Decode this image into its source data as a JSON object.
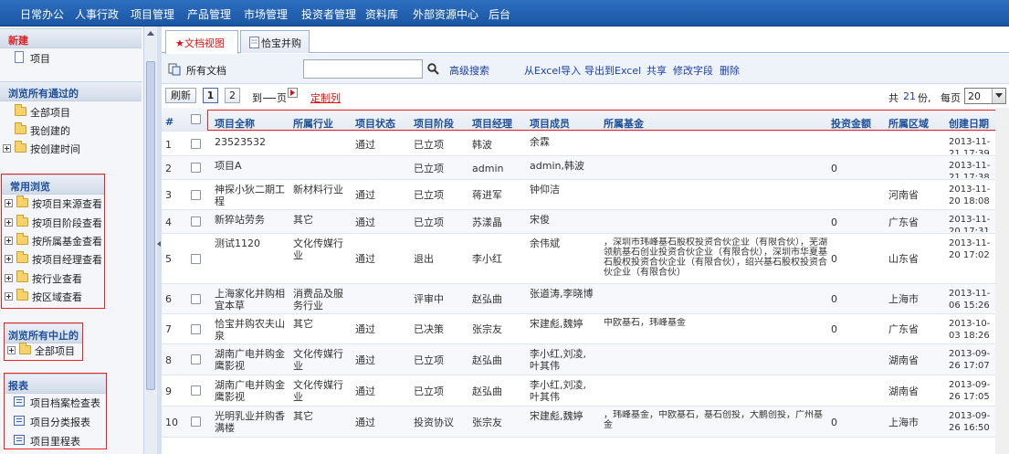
{
  "nav": [
    "日常办公",
    "人事行政",
    "项目管理",
    "产品管理",
    "市场管理",
    "投资者管理",
    "资料库",
    "外部资源中心",
    "后台"
  ],
  "sidebar": {
    "new_title": "新建",
    "new_items": [
      "项目"
    ],
    "browse_title": "浏览所有通过的",
    "browse_items": [
      "全部项目",
      "我创建的",
      "按创建时间"
    ],
    "common_title": "常用浏览",
    "common_items": [
      "按项目来源查看",
      "按项目阶段查看",
      "按所属基金查看",
      "按项目经理查看",
      "按行业查看",
      "按区域查看"
    ],
    "stopped_title": "浏览所有中止的",
    "stopped_items": [
      "全部项目"
    ],
    "reports_title": "报表",
    "report_items": [
      "项目档案检查表",
      "项目分类报表",
      "项目里程表"
    ]
  },
  "tabs": [
    "★文档视图",
    "恰宝并购"
  ],
  "toolbar": {
    "all_docs": "所有文档",
    "search_value": "",
    "advanced_search": "高级搜索",
    "import_excel": "从Excel导入",
    "export_excel": "导出到Excel",
    "share": "共享",
    "modify_fields": "修改字段",
    "delete": "删除"
  },
  "pager": {
    "refresh": "刷新",
    "pages": [
      "1",
      "2"
    ],
    "goto_prefix": "到",
    "goto_suffix": "页",
    "custom_columns": "定制列",
    "total_prefix": "共",
    "total_count": "21",
    "total_suffix": "份,",
    "per_page_label": "每页",
    "per_page": "20"
  },
  "columns": [
    "#",
    "",
    "项目全称",
    "所属行业",
    "项目状态",
    "项目阶段",
    "项目经理",
    "项目成员",
    "所属基金",
    "投资金额",
    "所属区域",
    "创建日期"
  ],
  "rows": [
    [
      "1",
      "",
      "23523532",
      "",
      "通过",
      "已立项",
      "韩波",
      "余霖",
      "",
      "",
      "",
      "2013-11-21 17:39"
    ],
    [
      "2",
      "",
      "项目A",
      "",
      "",
      "已立项",
      "admin",
      "admin,韩波",
      "",
      "0",
      "",
      "2013-11-21 17:38"
    ],
    [
      "3",
      "",
      "神探小狄二期工程",
      "新材料行业",
      "通过",
      "已立项",
      "蒋进军",
      "钟仰洁",
      "",
      "",
      "河南省",
      "2013-11-20 18:08"
    ],
    [
      "4",
      "",
      "新猝站劳务",
      "其它",
      "通过",
      "已立项",
      "苏漾晶",
      "宋俊",
      "",
      "0",
      "广东省",
      "2013-11-20 17:31"
    ],
    [
      "5",
      "",
      "测试1120",
      "文化传媒行业",
      "通过",
      "退出",
      "李小红",
      "余伟斌",
      "，深圳市玮峰基石股权投资合伙企业（有限合伙），芜湖领航基石创业投资合伙企业（有限合伙），深圳市华夏基石股权投资合伙企业（有限合伙），绍兴基石股权投资合伙企业（有限合伙）",
      "0",
      "山东省",
      "2013-11-20 17:02"
    ],
    [
      "6",
      "",
      "上海家化并购相宜本草",
      "消费品及服务行业",
      "",
      "评审中",
      "赵弘曲",
      "张道涛,李晓博",
      "",
      "0",
      "上海市",
      "2013-11-06 15:26"
    ],
    [
      "7",
      "",
      "恰宝并购农夫山泉",
      "其它",
      "通过",
      "已决策",
      "张宗友",
      "宋建彪,魏婷",
      "中欧基石，玮峰基金",
      "0",
      "广东省",
      "2013-10-03 18:26"
    ],
    [
      "8",
      "",
      "湖南广电并购金鹰影视",
      "文化传媒行业",
      "通过",
      "已立项",
      "赵弘曲",
      "李小红,刘凌,叶其伟",
      "",
      "",
      "湖南省",
      "2013-09-26 17:07"
    ],
    [
      "9",
      "",
      "湖南广电并购金鹰影视",
      "文化传媒行业",
      "通过",
      "已立项",
      "赵弘曲",
      "李小红,刘凌,叶其伟",
      "",
      "",
      "湖南省",
      "2013-09-26 17:05"
    ],
    [
      "10",
      "",
      "光明乳业并购香满楼",
      "其它",
      "通过",
      "投资协议",
      "张宗友",
      "宋建彪,魏婷",
      "，玮峰基金，中欧基石，基石创投，大鹏创投，广州基金",
      "0",
      "上海市",
      "2013-09-26 16:50"
    ]
  ],
  "colors": {
    "nav_bg": "#1a56a4",
    "header_text": "#1d4f9c",
    "link": "#1a3faa",
    "highlight": "#e22"
  }
}
